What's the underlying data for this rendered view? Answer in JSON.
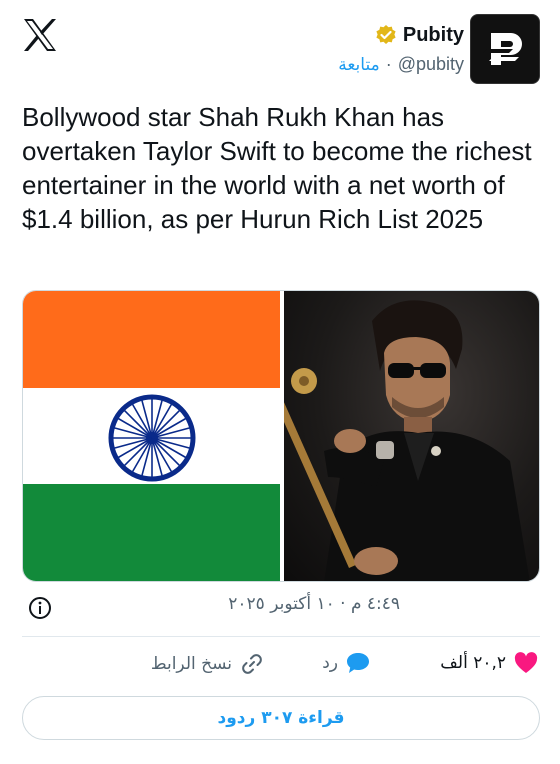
{
  "author": {
    "name": "Pubity",
    "handle": "@pubity",
    "separator": "·",
    "follow_label": "متابعة"
  },
  "tweet": {
    "text": "Bollywood star Shah Rukh Khan has overtaken Taylor Swift to become the richest entertainer in the world with a net worth of $1.4 billion, as per Hurun Rich List 2025",
    "timestamp": "٤:٤٩ م · ١٠ أكتوبر ٢٠٢٥"
  },
  "actions": {
    "like_count": "٢٠,٢ ألف",
    "reply_label": "رد",
    "copy_link_label": "نسخ الرابط"
  },
  "read_replies_label": "قراءة ٣٠٧ ردود",
  "colors": {
    "accent": "#1d9bf0",
    "like": "#f91880",
    "verified": "#e2b719",
    "flag_saffron": "#ff6b1a",
    "flag_green": "#128a3a",
    "chakra": "#0a2a8a"
  },
  "icons": [
    "x-logo-icon",
    "verified-badge-icon",
    "pubity-logo-icon",
    "info-icon",
    "heart-icon",
    "reply-bubble-icon",
    "link-icon"
  ]
}
